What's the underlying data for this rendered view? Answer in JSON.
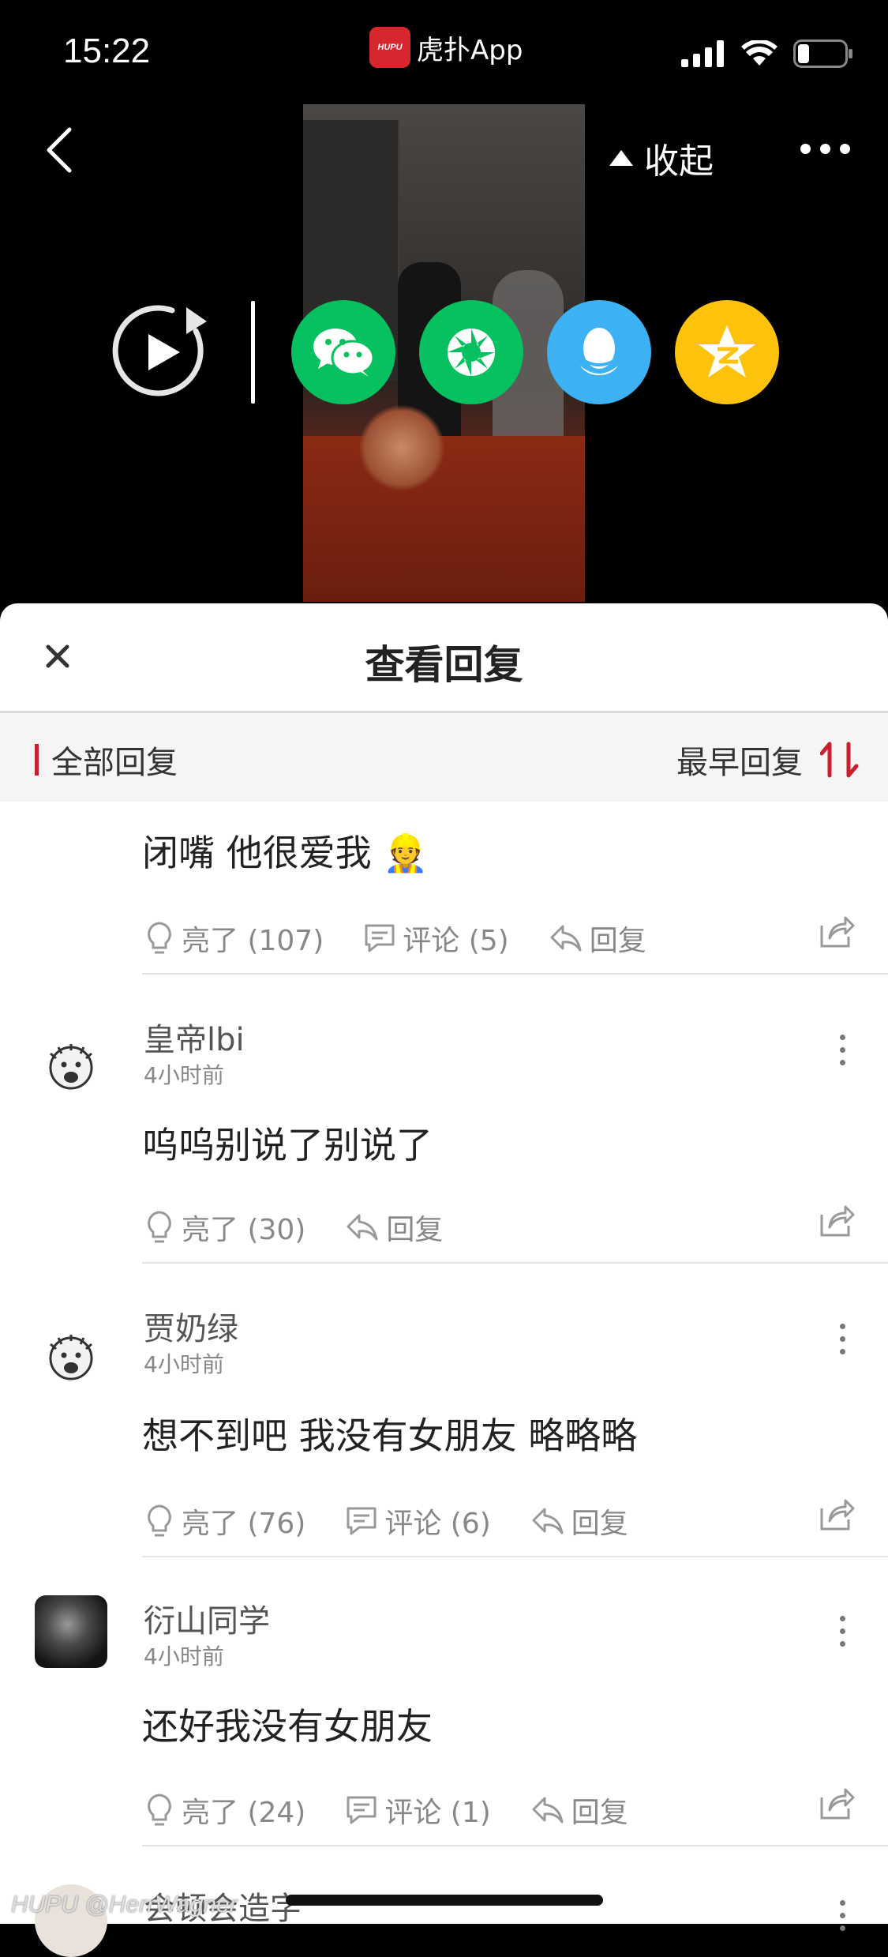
{
  "status_bar": {
    "time": "15:22",
    "app_name": "虎扑App",
    "logo_text": "HUPU"
  },
  "header": {
    "collapse_label": "收起"
  },
  "share": {
    "items": [
      "wechat-icon",
      "moments-icon",
      "qq-icon",
      "qzone-icon"
    ],
    "colors": {
      "wechat": "#07c160",
      "moments": "#07c160",
      "qq": "#3cb2f5",
      "qzone": "#fdc20c"
    }
  },
  "sheet": {
    "title": "查看回复",
    "filter_label": "全部回复",
    "sort_label": "最早回复",
    "accent": "#c8202e"
  },
  "comments": [
    {
      "text": "闭嘴 他很爱我 👷",
      "like": "亮了 (107)",
      "comment": "评论 (5)",
      "reply": "回复"
    },
    {
      "user": "皇帝lbi",
      "time": "4小时前",
      "text": "呜呜别说了别说了",
      "like": "亮了 (30)",
      "reply": "回复"
    },
    {
      "user": "贾奶绿",
      "time": "4小时前",
      "text": "想不到吧 我没有女朋友 略略略",
      "like": "亮了 (76)",
      "comment": "评论 (6)",
      "reply": "回复"
    },
    {
      "user": "衍山同学",
      "time": "4小时前",
      "text": "还好我没有女朋友",
      "like": "亮了 (24)",
      "comment": "评论 (1)",
      "reply": "回复"
    },
    {
      "user": "会顿会造字"
    }
  ],
  "watermark": "HUPU @HerrWagner"
}
